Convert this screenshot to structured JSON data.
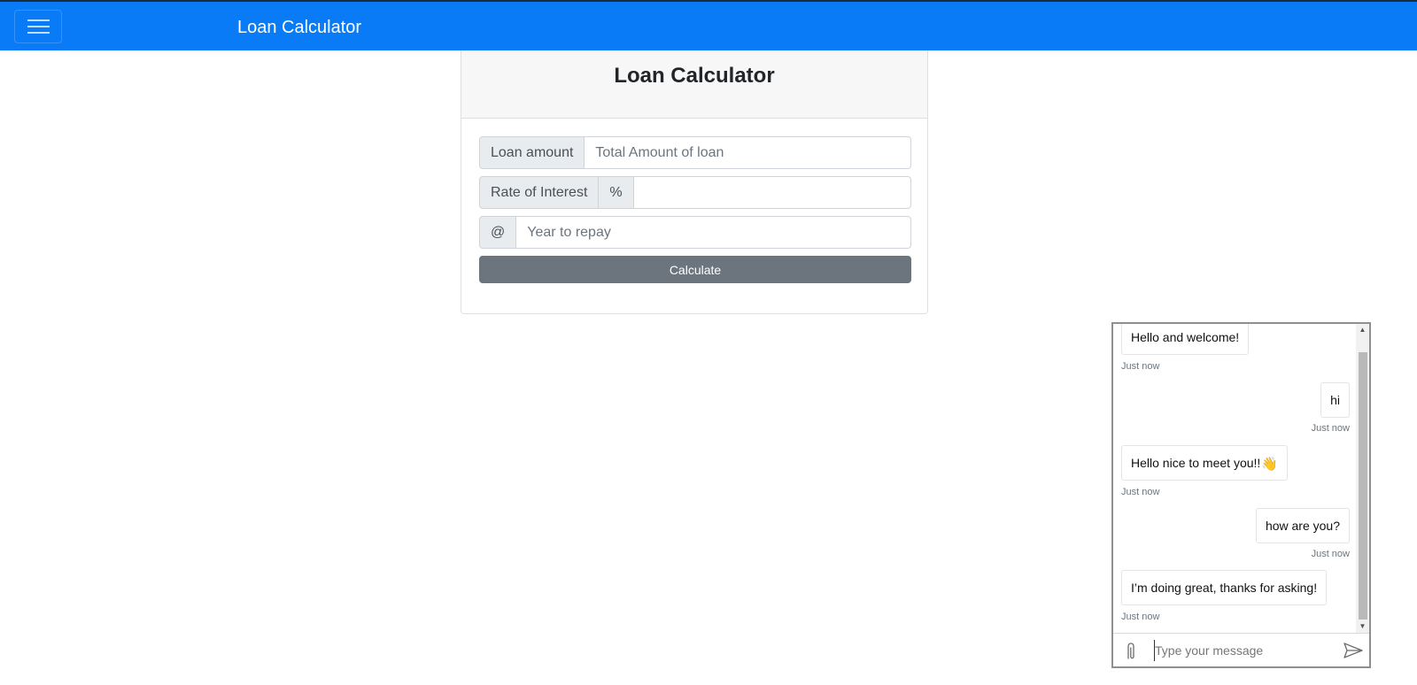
{
  "navbar": {
    "brand": "Loan Calculator",
    "color": "#0a7bf6"
  },
  "card": {
    "title": "Loan Calculator",
    "loan_amount": {
      "label": "Loan amount",
      "placeholder": "Total Amount of loan",
      "value": ""
    },
    "interest": {
      "label": "Rate of Interest",
      "suffix_label": "%",
      "value": ""
    },
    "years": {
      "label": "@",
      "placeholder": "Year to repay",
      "value": ""
    },
    "calculate_label": "Calculate"
  },
  "chat": {
    "messages": [
      {
        "side": "left",
        "text": "Hello and welcome!",
        "time": "Just now"
      },
      {
        "side": "right",
        "text": "hi",
        "time": "Just now"
      },
      {
        "side": "left",
        "text": "Hello nice to meet you!!",
        "emoji": "👋",
        "time": "Just now"
      },
      {
        "side": "right",
        "text": "how are you?",
        "time": "Just now"
      },
      {
        "side": "left",
        "text": "I’m doing great, thanks for asking!",
        "time": "Just now"
      }
    ],
    "input_placeholder": "Type your message",
    "icons": {
      "attach": "paperclip-icon",
      "send": "send-icon"
    }
  }
}
